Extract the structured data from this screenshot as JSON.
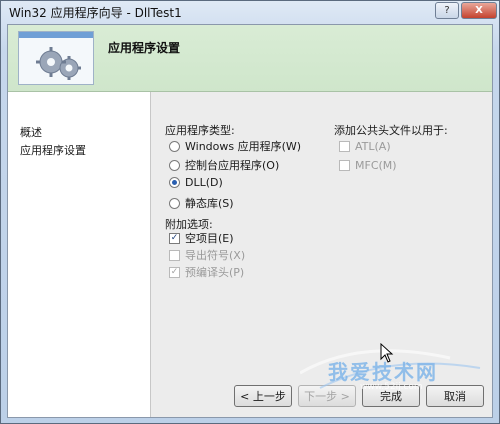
{
  "window": {
    "title": "Win32 应用程序向导 - DllTest1",
    "help_label": "?",
    "close_label": "X"
  },
  "banner": {
    "title": "应用程序设置"
  },
  "leftnav": {
    "items": [
      {
        "label": "概述"
      },
      {
        "label": "应用程序设置"
      }
    ]
  },
  "app_type": {
    "heading": "应用程序类型:",
    "options": [
      {
        "label": "Windows 应用程序(W)",
        "selected": false
      },
      {
        "label": "控制台应用程序(O)",
        "selected": false
      },
      {
        "label": "DLL(D)",
        "selected": true
      },
      {
        "label": "静态库(S)",
        "selected": false
      }
    ]
  },
  "extra": {
    "heading": "附加选项:",
    "options": [
      {
        "label": "空项目(E)",
        "checked": true,
        "enabled": true
      },
      {
        "label": "导出符号(X)",
        "checked": false,
        "enabled": false
      },
      {
        "label": "预编译头(P)",
        "checked": true,
        "enabled": false
      }
    ]
  },
  "common_headers": {
    "heading": "添加公共头文件以用于:",
    "options": [
      {
        "label": "ATL(A)",
        "enabled": false
      },
      {
        "label": "MFC(M)",
        "enabled": false
      }
    ]
  },
  "buttons": {
    "prev": "< 上一步",
    "next": "下一步 >",
    "finish": "完成",
    "cancel": "取消"
  },
  "watermark": {
    "text": "我爱技术网",
    "url": "www.52ij.com"
  }
}
